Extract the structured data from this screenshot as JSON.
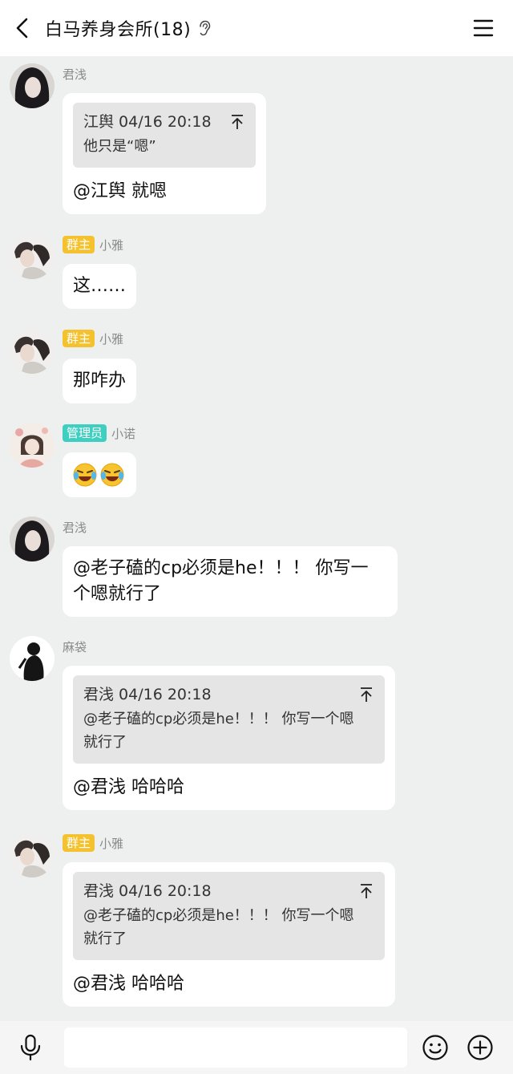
{
  "header": {
    "title": "白马养身会所(18)"
  },
  "input": {
    "placeholder": ""
  },
  "messages": [
    {
      "sender": "君浅",
      "badge": "",
      "quote": {
        "head": "江舆 04/16 20:18",
        "body": "他只是“嗯”"
      },
      "text": "@江舆 就嗯"
    },
    {
      "sender": "小雅",
      "badge": "群主",
      "text": "这……"
    },
    {
      "sender": "小雅",
      "badge": "群主",
      "text": "那咋办"
    },
    {
      "sender": "小诺",
      "badge": "管理员",
      "emojis": [
        "laughing-crying-emoji",
        "laughing-crying-emoji"
      ]
    },
    {
      "sender": "君浅",
      "badge": "",
      "text": "@老子磕的cp必须是he！！！ 你写一\n个嗯就行了"
    },
    {
      "sender": "麻袋",
      "badge": "",
      "quote": {
        "head": "君浅 04/16 20:18",
        "body": "@老子磕的cp必须是he！！！ 你写一个嗯\n就行了"
      },
      "text": "@君浅 哈哈哈"
    },
    {
      "sender": "小雅",
      "badge": "群主",
      "quote": {
        "head": "君浅 04/16 20:18",
        "body": "@老子磕的cp必须是he！！！ 你写一个嗯\n就行了"
      },
      "text": "@君浅 哈哈哈"
    }
  ],
  "colors": {
    "owner_badge": "#f5c22f",
    "admin_badge": "#3ecfc0",
    "background": "#edf0ee"
  }
}
